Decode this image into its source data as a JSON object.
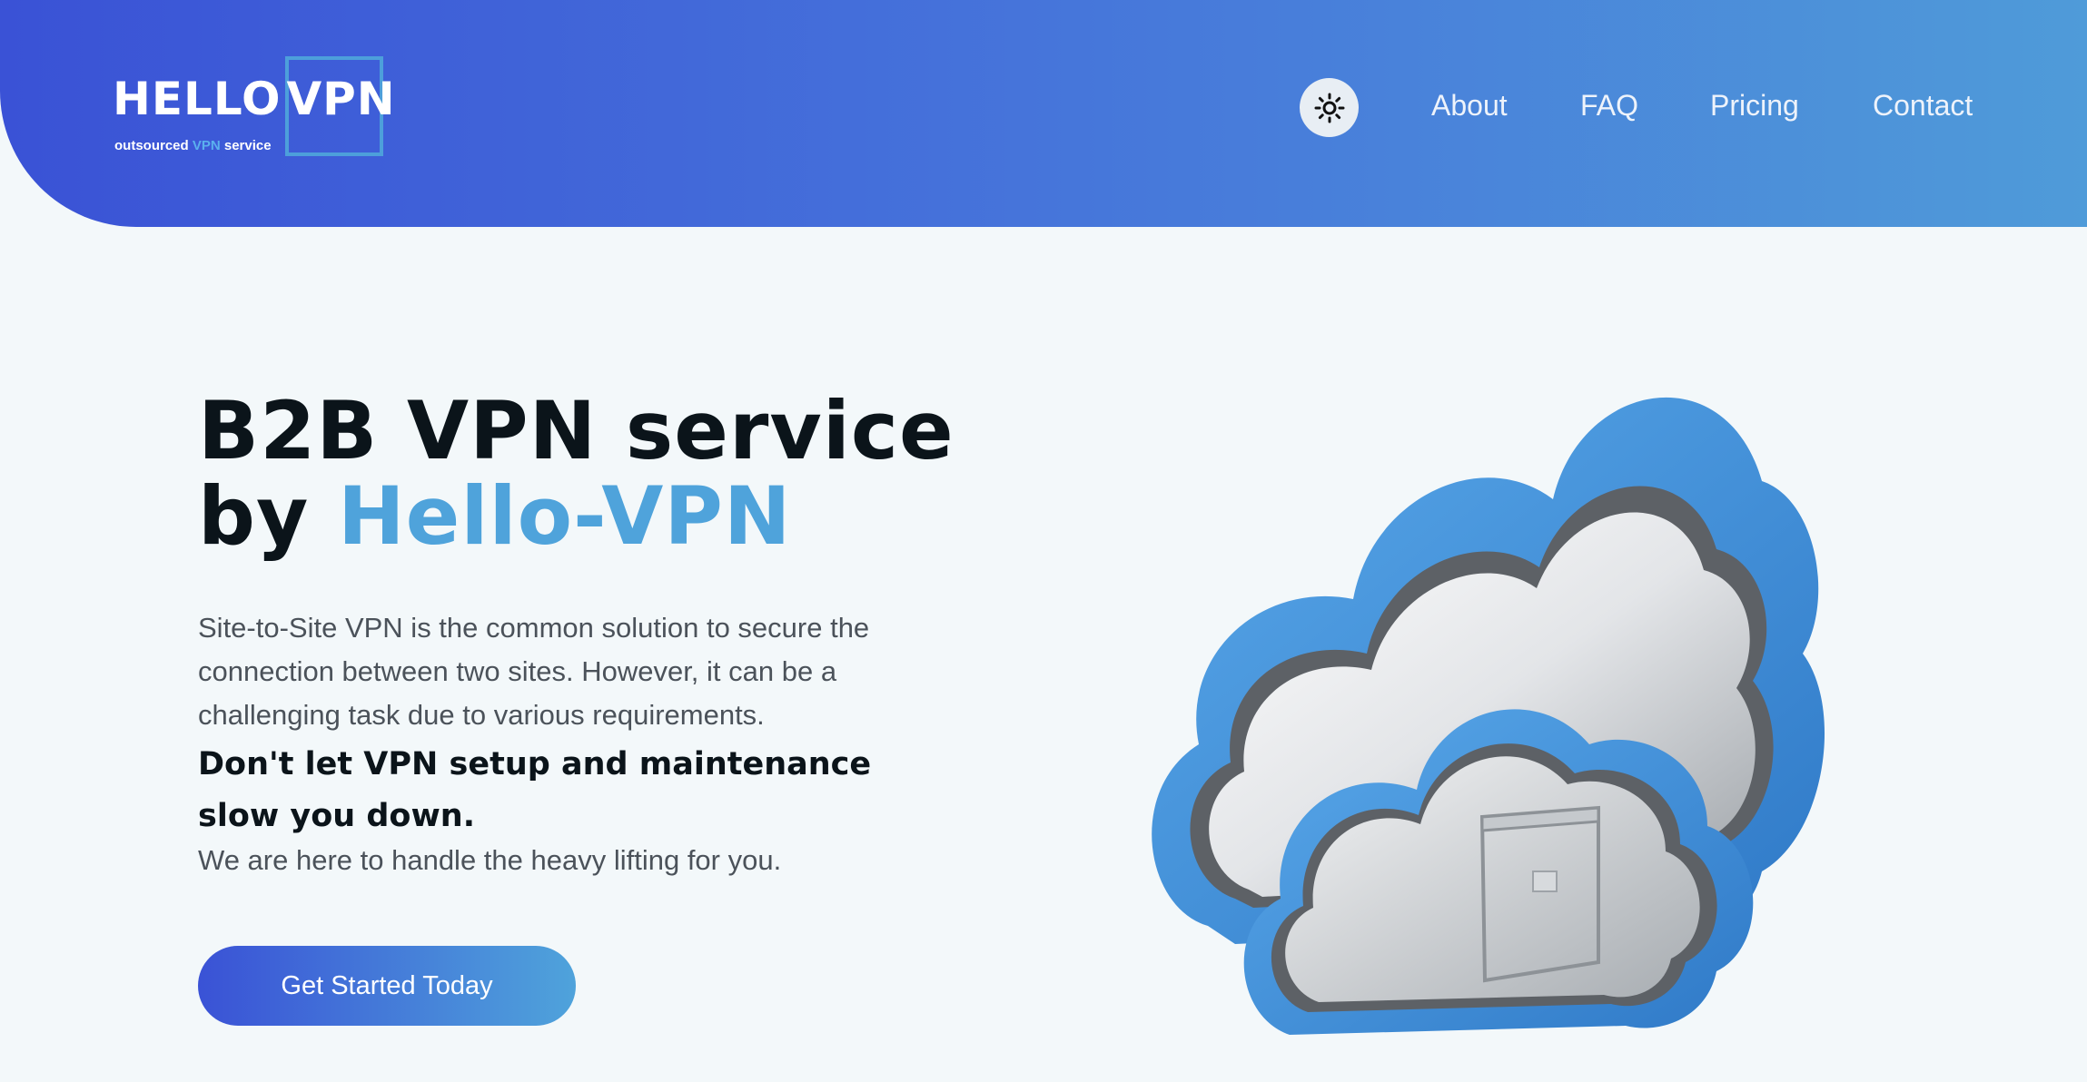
{
  "brand": {
    "name_part1": "HELLO",
    "name_part2": "VPN",
    "tagline_pre": "outsourced",
    "tagline_vpn": "VPN",
    "tagline_post": "service"
  },
  "nav": {
    "items": [
      {
        "label": "About"
      },
      {
        "label": "FAQ"
      },
      {
        "label": "Pricing"
      },
      {
        "label": "Contact"
      }
    ],
    "theme_icon": "sun-icon"
  },
  "hero": {
    "title_line1": "B2B VPN service",
    "title_by": "by",
    "title_brand": "Hello-VPN",
    "description": "Site-to-Site VPN is the common solution to secure the connection between two sites. However, it can be a challenging task due to various requirements.",
    "emphasis": "Don't let VPN setup and maintenance slow you down.",
    "subtext": "We are here to handle the heavy lifting for you.",
    "cta_label": "Get Started Today",
    "illustration_icon": "cloud-lock-icon"
  },
  "colors": {
    "header_start": "#3a52d6",
    "header_end": "#4f9bd9",
    "accent": "#4fa3db",
    "background": "#f3f8fa",
    "heading": "#0b141a",
    "body_text": "#4b525a"
  }
}
